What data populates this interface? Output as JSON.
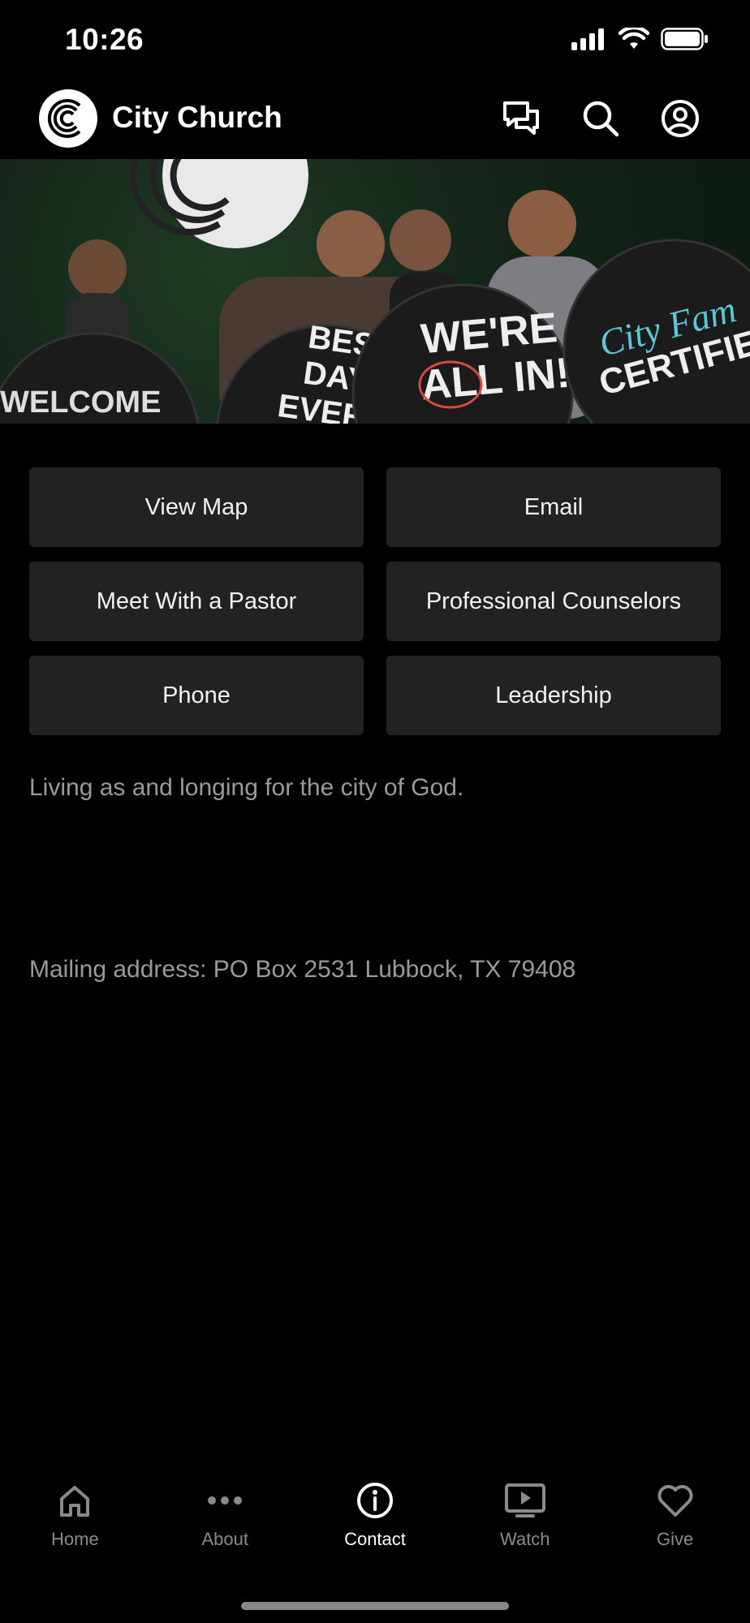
{
  "status_bar": {
    "time": "10:26"
  },
  "header": {
    "brand": "City Church",
    "icons": [
      "chat-icon",
      "search-icon",
      "account-icon"
    ]
  },
  "hero": {
    "signs": [
      "WELCOME",
      "BEST DAY EVER!",
      "WE'RE ALL IN!",
      "City Fam CERTIFIED!"
    ]
  },
  "buttons": {
    "view_map": "View Map",
    "email": "Email",
    "meet_pastor": "Meet With a Pastor",
    "counselors": "Professional Counselors",
    "phone": "Phone",
    "leadership": "Leadership"
  },
  "content": {
    "tagline": "Living as and longing for the city of God.",
    "mailing": "Mailing address: PO Box 2531 Lubbock, TX 79408"
  },
  "tabs": [
    {
      "label": "Home",
      "icon": "home-icon"
    },
    {
      "label": "About",
      "icon": "more-icon"
    },
    {
      "label": "Contact",
      "icon": "info-icon",
      "active": true
    },
    {
      "label": "Watch",
      "icon": "play-icon"
    },
    {
      "label": "Give",
      "icon": "heart-icon"
    }
  ]
}
